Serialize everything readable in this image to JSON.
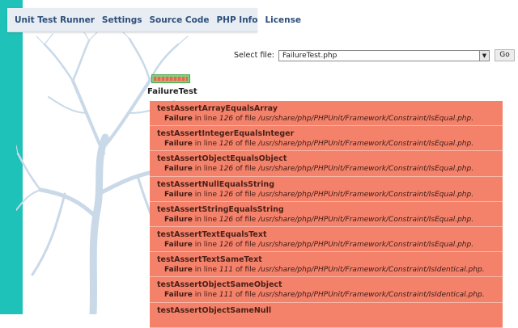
{
  "nav": {
    "items": [
      "Unit Test Runner",
      "Settings",
      "Source Code",
      "PHP Info",
      "License"
    ]
  },
  "selector": {
    "label": "Select file:",
    "value": "FailureTest.php",
    "go_label": "Go"
  },
  "progress": {
    "passed_fraction": 0
  },
  "suite": {
    "title": "FailureTest",
    "results": [
      {
        "name": "testAssertArrayEqualsArray",
        "status": "Failure",
        "pre": "in line",
        "line": "126",
        "mid": "of file",
        "file": "/usr/share/php/PHPUnit/Framework/Constraint/IsEqual.php."
      },
      {
        "name": "testAssertIntegerEqualsInteger",
        "status": "Failure",
        "pre": "in line",
        "line": "126",
        "mid": "of file",
        "file": "/usr/share/php/PHPUnit/Framework/Constraint/IsEqual.php."
      },
      {
        "name": "testAssertObjectEqualsObject",
        "status": "Failure",
        "pre": "in line",
        "line": "126",
        "mid": "of file",
        "file": "/usr/share/php/PHPUnit/Framework/Constraint/IsEqual.php."
      },
      {
        "name": "testAssertNullEqualsString",
        "status": "Failure",
        "pre": "in line",
        "line": "126",
        "mid": "of file",
        "file": "/usr/share/php/PHPUnit/Framework/Constraint/IsEqual.php."
      },
      {
        "name": "testAssertStringEqualsString",
        "status": "Failure",
        "pre": "in line",
        "line": "126",
        "mid": "of file",
        "file": "/usr/share/php/PHPUnit/Framework/Constraint/IsEqual.php."
      },
      {
        "name": "testAssertTextEqualsText",
        "status": "Failure",
        "pre": "in line",
        "line": "126",
        "mid": "of file",
        "file": "/usr/share/php/PHPUnit/Framework/Constraint/IsEqual.php."
      },
      {
        "name": "testAssertTextSameText",
        "status": "Failure",
        "pre": "in line",
        "line": "111",
        "mid": "of file",
        "file": "/usr/share/php/PHPUnit/Framework/Constraint/IsIdentical.php."
      },
      {
        "name": "testAssertObjectSameObject",
        "status": "Failure",
        "pre": "in line",
        "line": "111",
        "mid": "of file",
        "file": "/usr/share/php/PHPUnit/Framework/Constraint/IsIdentical.php."
      },
      {
        "name": "testAssertObjectSameNull",
        "status": "",
        "pre": "",
        "line": "",
        "mid": "",
        "file": ""
      }
    ]
  },
  "colors": {
    "accent": "#1fc2b8",
    "nav_text": "#2e4f7a",
    "failure_row": "#f4826b"
  }
}
